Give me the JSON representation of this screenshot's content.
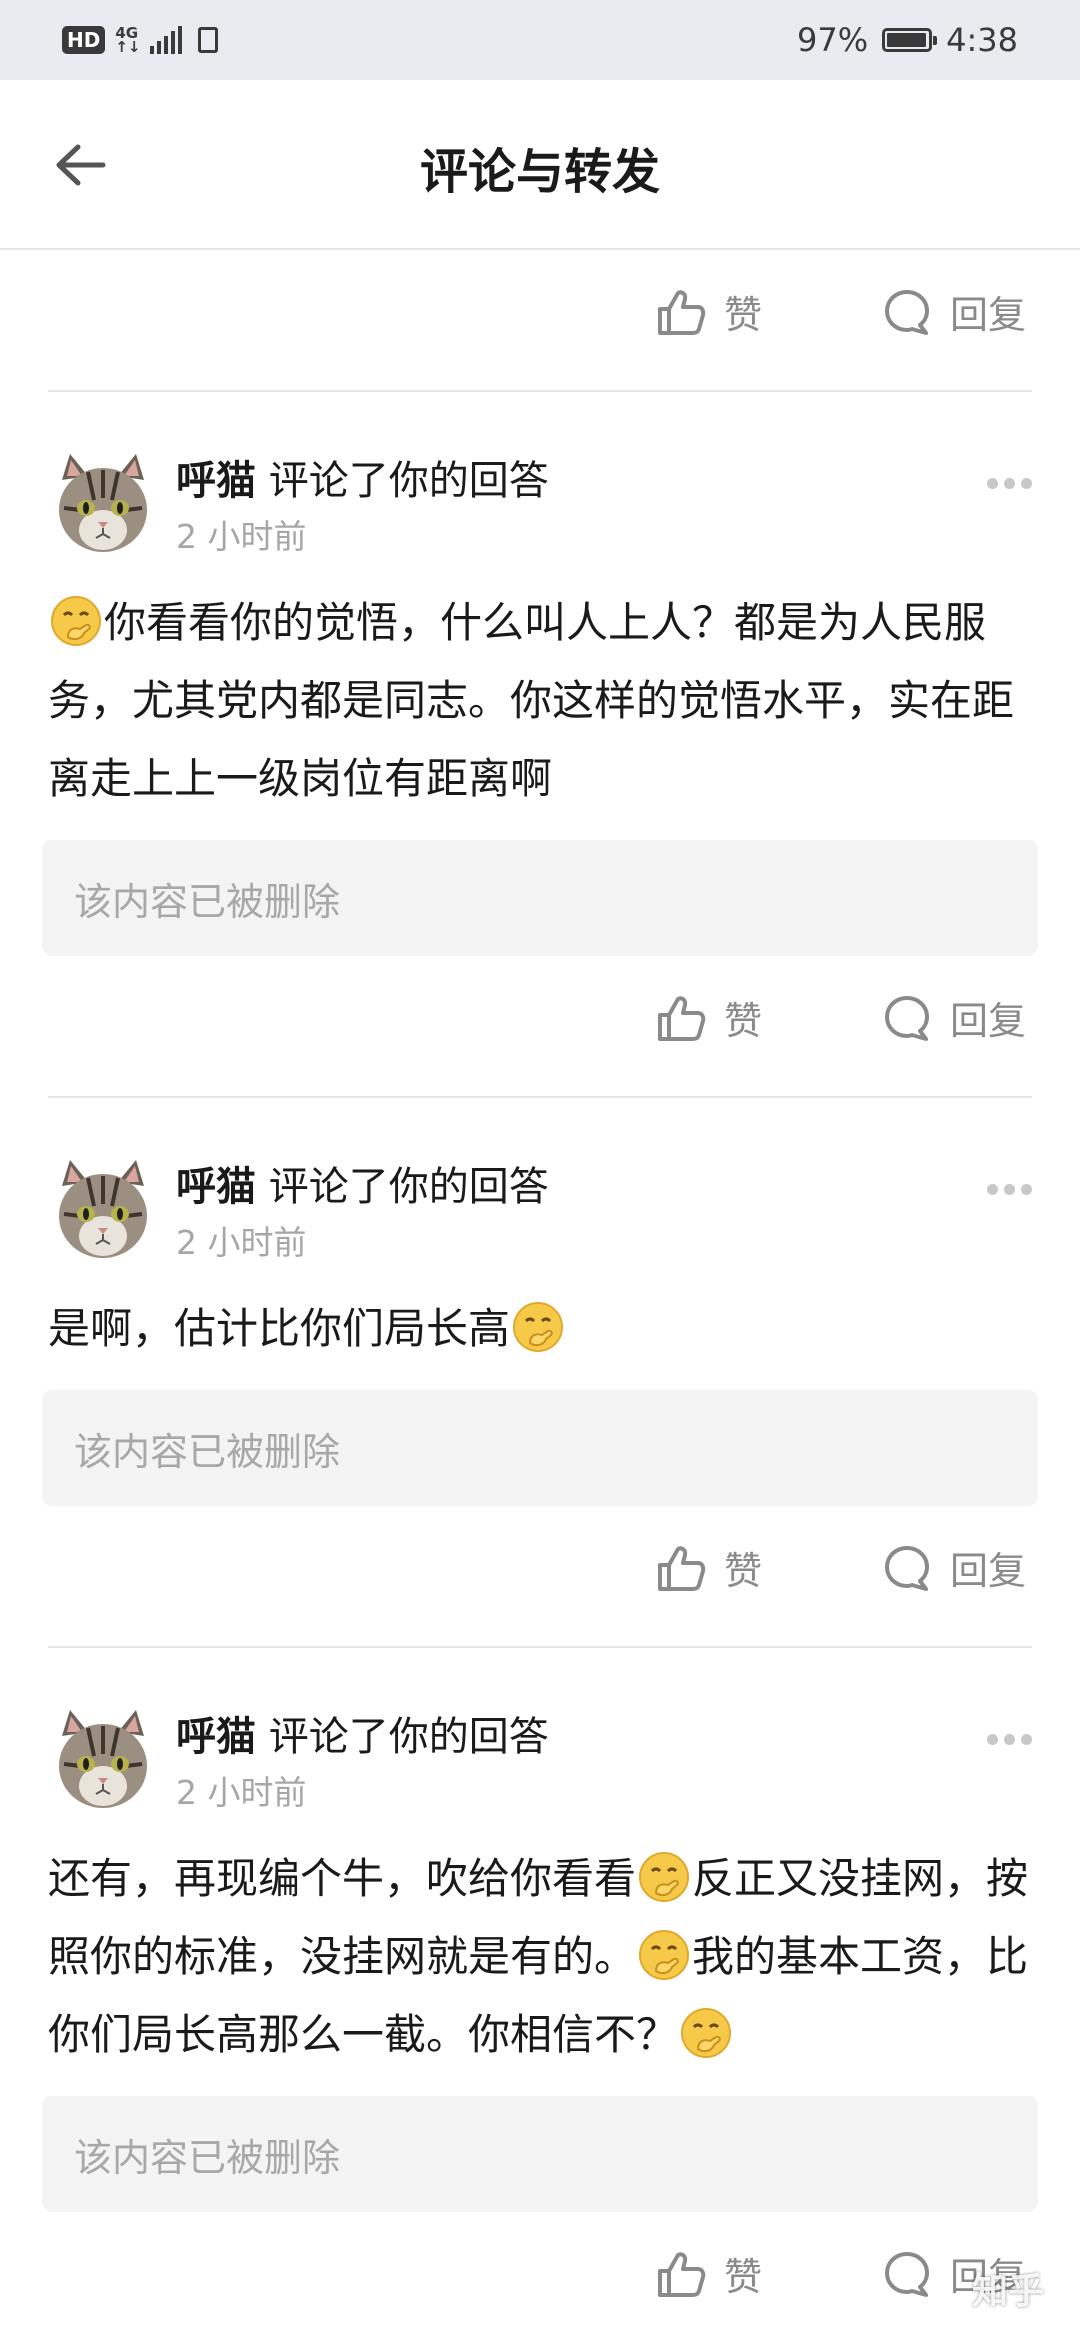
{
  "status_bar": {
    "hd_label": "HD",
    "network_label": "4G",
    "network_sub": "↑↓",
    "battery_percent_text": "97%",
    "battery_level": 0.97,
    "time": "4:38"
  },
  "header": {
    "back_icon": "arrow-left-icon",
    "title": "评论与转发"
  },
  "actions": {
    "like_label": "赞",
    "reply_label": "回复"
  },
  "comments": [
    {
      "author": "呼猫",
      "action_text": "评论了你的回答",
      "time": "2 小时前",
      "text_parts": [
        "你看看你的觉悟，什么叫人上人？都是为人民服务，尤其党内都是同志。你这样的觉悟水平，实在距离走上上一级岗位有距离啊"
      ],
      "deleted_text": "该内容已被删除"
    },
    {
      "author": "呼猫",
      "action_text": "评论了你的回答",
      "time": "2 小时前",
      "text_parts": [
        "是啊，估计比你们局长高"
      ],
      "deleted_text": "该内容已被删除"
    },
    {
      "author": "呼猫",
      "action_text": "评论了你的回答",
      "time": "2 小时前",
      "text_parts": [
        "还有，再现编个牛，吹给你看看",
        "反正又没挂网，按照你的标准，没挂网就是有的。",
        "我的基本工资，比你们局长高那么一截。你相信不？"
      ],
      "deleted_text": "该内容已被删除"
    }
  ],
  "watermark": "知乎",
  "colors": {
    "status_bar_bg": "#e8ebef",
    "muted_text": "#8a8a8a",
    "deleted_box_bg": "#f4f4f5"
  }
}
